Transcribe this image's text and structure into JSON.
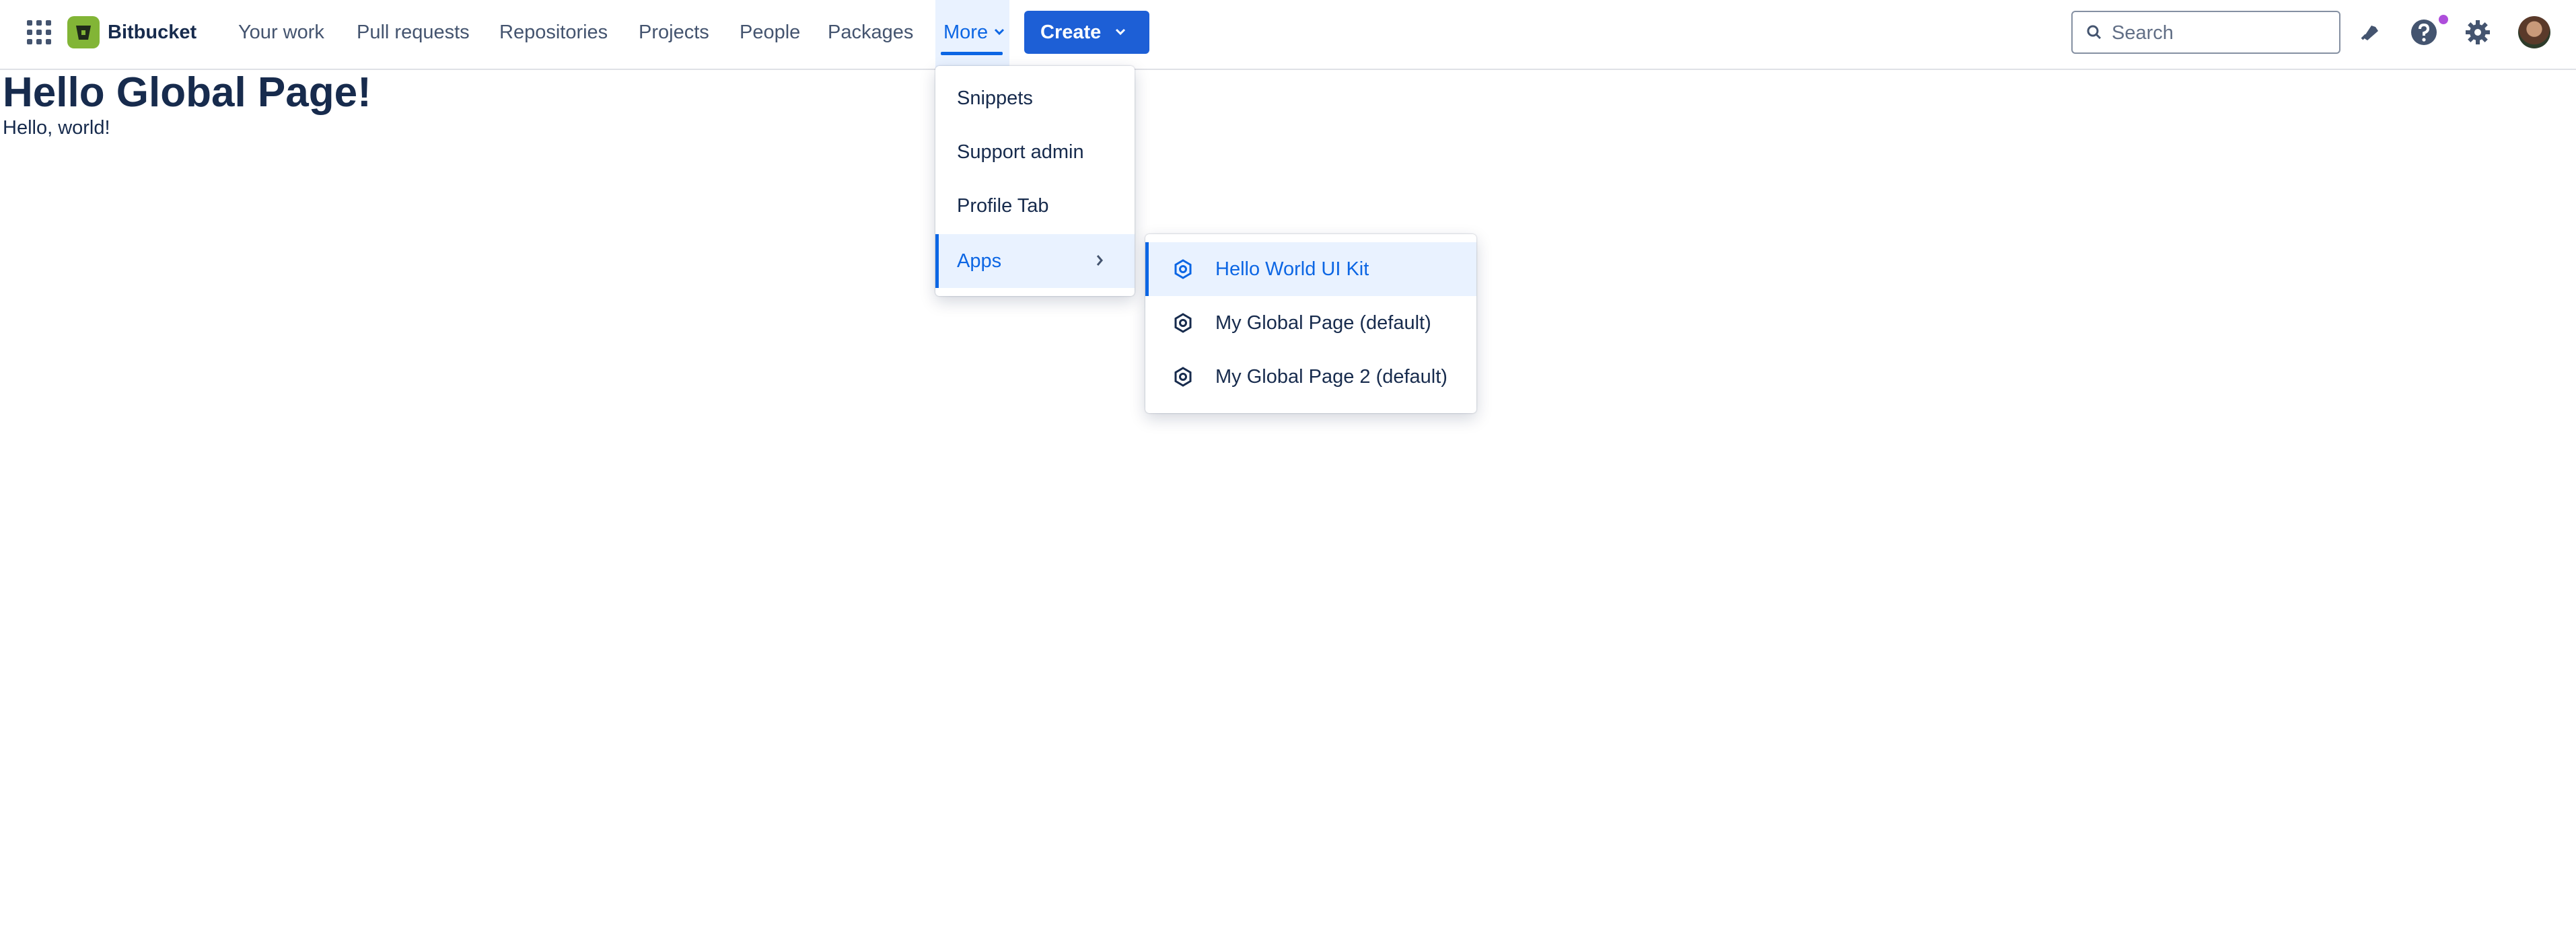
{
  "brand": {
    "name": "Bitbucket"
  },
  "nav": {
    "items": [
      {
        "label": "Your work"
      },
      {
        "label": "Pull requests"
      },
      {
        "label": "Repositories"
      },
      {
        "label": "Projects"
      },
      {
        "label": "People"
      },
      {
        "label": "Packages"
      }
    ],
    "more_label": "More",
    "create_label": "Create"
  },
  "search": {
    "placeholder": "Search"
  },
  "header_icons": [
    "notifications-icon",
    "help-icon",
    "settings-icon",
    "avatar"
  ],
  "page": {
    "heading": "Hello Global Page!",
    "text": "Hello, world!"
  },
  "more_menu": {
    "items": [
      {
        "label": "Snippets"
      },
      {
        "label": "Support admin"
      },
      {
        "label": "Profile Tab"
      },
      {
        "label": "Apps",
        "active": true,
        "has_submenu": true
      }
    ]
  },
  "apps_menu": {
    "items": [
      {
        "label": "Hello World UI Kit",
        "active": true
      },
      {
        "label": "My Global Page (default)"
      },
      {
        "label": "My Global Page 2 (default)"
      }
    ]
  },
  "colors": {
    "accent": "#0c66e4",
    "create_button": "#1d5fd6",
    "brand_logo": "#82b536",
    "selected_bg": "#e9f2ff",
    "text": "#172b4d",
    "notification_dot": "#ae4edb"
  }
}
